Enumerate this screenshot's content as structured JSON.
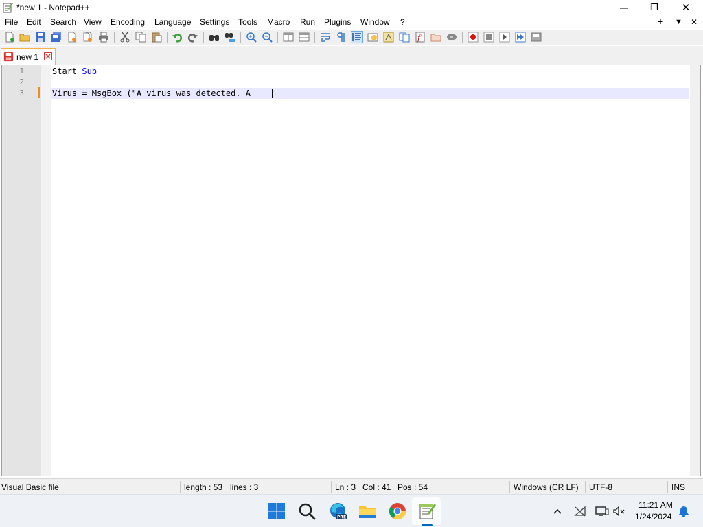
{
  "window": {
    "title": "*new 1 - Notepad++",
    "minimize_glyph": "—",
    "restore_glyph": "❐",
    "close_glyph": "✕"
  },
  "menu": {
    "items": [
      "File",
      "Edit",
      "Search",
      "View",
      "Encoding",
      "Language",
      "Settings",
      "Tools",
      "Macro",
      "Run",
      "Plugins",
      "Window",
      "?"
    ],
    "right_plus": "+",
    "right_arrow": "▼",
    "right_close": "✕"
  },
  "toolbar": {
    "icons": [
      "new-file-icon",
      "open-file-icon",
      "save-icon",
      "save-all-icon",
      "close-icon",
      "close-all-icon",
      "print-icon",
      "cut-icon",
      "copy-icon",
      "paste-icon",
      "undo-icon",
      "redo-icon",
      "find-icon",
      "replace-icon",
      "zoom-in-icon",
      "zoom-out-icon",
      "sync-vertical-icon",
      "sync-horizontal-icon",
      "word-wrap-icon",
      "show-all-chars-icon",
      "indent-guide-icon",
      "user-defined-language-icon",
      "document-map-icon",
      "document-list-icon",
      "function-list-icon",
      "folder-as-workspace-icon",
      "monitoring-icon",
      "record-macro-icon",
      "stop-recording-icon",
      "playback-macro-icon",
      "run-macro-multiple-icon",
      "save-macro-icon"
    ]
  },
  "tab": {
    "label": "new 1"
  },
  "editor": {
    "lines": [
      {
        "number": "1",
        "parts": [
          {
            "text": "Start ",
            "kind": "plain"
          },
          {
            "text": "Sub",
            "kind": "keyword"
          }
        ]
      },
      {
        "number": "2",
        "parts": []
      },
      {
        "number": "3",
        "parts": [
          {
            "text": "Virus = MsgBox (\"A virus was detected. A",
            "kind": "plain"
          }
        ]
      }
    ],
    "keyword_color": "#0000ff",
    "current_line_color": "#e8e8ff",
    "change_marker_color": "#f08c20"
  },
  "status": {
    "file_type": "Visual Basic file",
    "length": "length : 53",
    "lines": "lines : 3",
    "ln": "Ln : 3",
    "col": "Col : 41",
    "pos": "Pos : 54",
    "eol": "Windows (CR LF)",
    "encoding": "UTF-8",
    "mode": "INS"
  },
  "taskbar": {
    "apps": [
      "windows-start-icon",
      "search-icon",
      "edge-beta-icon",
      "file-explorer-icon",
      "chrome-icon",
      "notepad-plus-plus-icon"
    ],
    "edge_badge": "PRE",
    "time": "11:21 AM",
    "date": "1/24/2024"
  }
}
